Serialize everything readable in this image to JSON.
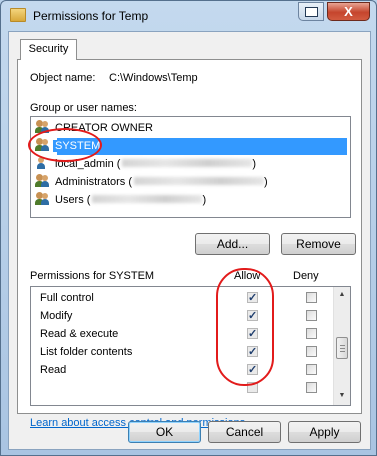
{
  "window": {
    "title": "Permissions for Temp",
    "close_glyph": "X"
  },
  "tabs": [
    {
      "label": "Security"
    }
  ],
  "object_name": {
    "label": "Object name:",
    "value": "C:\\Windows\\Temp"
  },
  "group_list": {
    "label": "Group or user names:",
    "items": [
      {
        "name": "CREATOR OWNER",
        "selected": false,
        "icon": "user-group-icon"
      },
      {
        "name": "SYSTEM",
        "selected": true,
        "icon": "user-group-icon"
      },
      {
        "name": "local_admin (",
        "selected": false,
        "icon": "user-icon",
        "redacted": true,
        "suffix": ")"
      },
      {
        "name": "Administrators (",
        "selected": false,
        "icon": "user-group-icon",
        "redacted": true,
        "suffix": ")"
      },
      {
        "name": "Users (",
        "selected": false,
        "icon": "user-group-icon",
        "redacted": true,
        "suffix": ")"
      }
    ]
  },
  "buttons": {
    "add": "Add...",
    "remove": "Remove",
    "ok": "OK",
    "cancel": "Cancel",
    "apply": "Apply"
  },
  "permissions": {
    "label": "Permissions for SYSTEM",
    "allow_header": "Allow",
    "deny_header": "Deny",
    "rows": [
      {
        "name": "Full control",
        "allow": true,
        "deny": false
      },
      {
        "name": "Modify",
        "allow": true,
        "deny": false
      },
      {
        "name": "Read & execute",
        "allow": true,
        "deny": false
      },
      {
        "name": "List folder contents",
        "allow": true,
        "deny": false
      },
      {
        "name": "Read",
        "allow": true,
        "deny": false
      }
    ]
  },
  "help_link": "Learn about access control and permissions",
  "colors": {
    "selection": "#3399ff",
    "annotation": "#e21b1b",
    "link": "#0066cc"
  }
}
